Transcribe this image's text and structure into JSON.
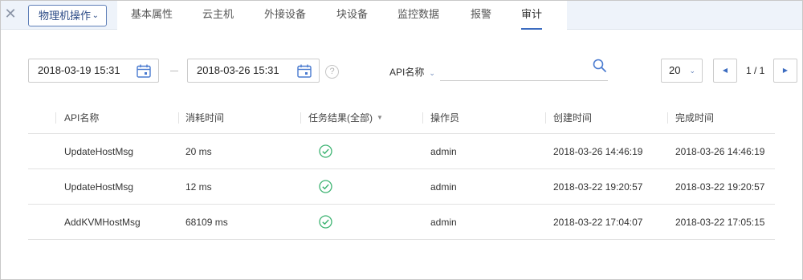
{
  "header": {
    "action_label": "物理机操作",
    "tabs": [
      {
        "label": "基本属性"
      },
      {
        "label": "云主机"
      },
      {
        "label": "外接设备"
      },
      {
        "label": "块设备"
      },
      {
        "label": "监控数据"
      },
      {
        "label": "报警"
      },
      {
        "label": "审计",
        "active": true
      }
    ]
  },
  "filters": {
    "start_date": "2018-03-19 15:31",
    "end_date": "2018-03-26 15:31",
    "help_glyph": "?",
    "search_field_label": "API名称",
    "search_value": "",
    "page_size": "20",
    "page_info": "1 / 1"
  },
  "table": {
    "columns": [
      "API名称",
      "消耗时间",
      "任务结果(全部)",
      "操作员",
      "创建时间",
      "完成时间"
    ],
    "rows": [
      {
        "api": "UpdateHostMsg",
        "duration": "20 ms",
        "result": "success",
        "operator": "admin",
        "created": "2018-03-26 14:46:19",
        "finished": "2018-03-26 14:46:19"
      },
      {
        "api": "UpdateHostMsg",
        "duration": "12 ms",
        "result": "success",
        "operator": "admin",
        "created": "2018-03-22 19:20:57",
        "finished": "2018-03-22 19:20:57"
      },
      {
        "api": "AddKVMHostMsg",
        "duration": "68109 ms",
        "result": "success",
        "operator": "admin",
        "created": "2018-03-22 17:04:07",
        "finished": "2018-03-22 17:05:15"
      }
    ]
  },
  "colors": {
    "accent": "#3c6cc0",
    "success": "#3cb371",
    "topbar_bg": "#eef3fa"
  },
  "icons": {
    "close": "close-icon",
    "calendar": "calendar-icon",
    "search": "search-icon",
    "success": "check-circle-icon"
  }
}
